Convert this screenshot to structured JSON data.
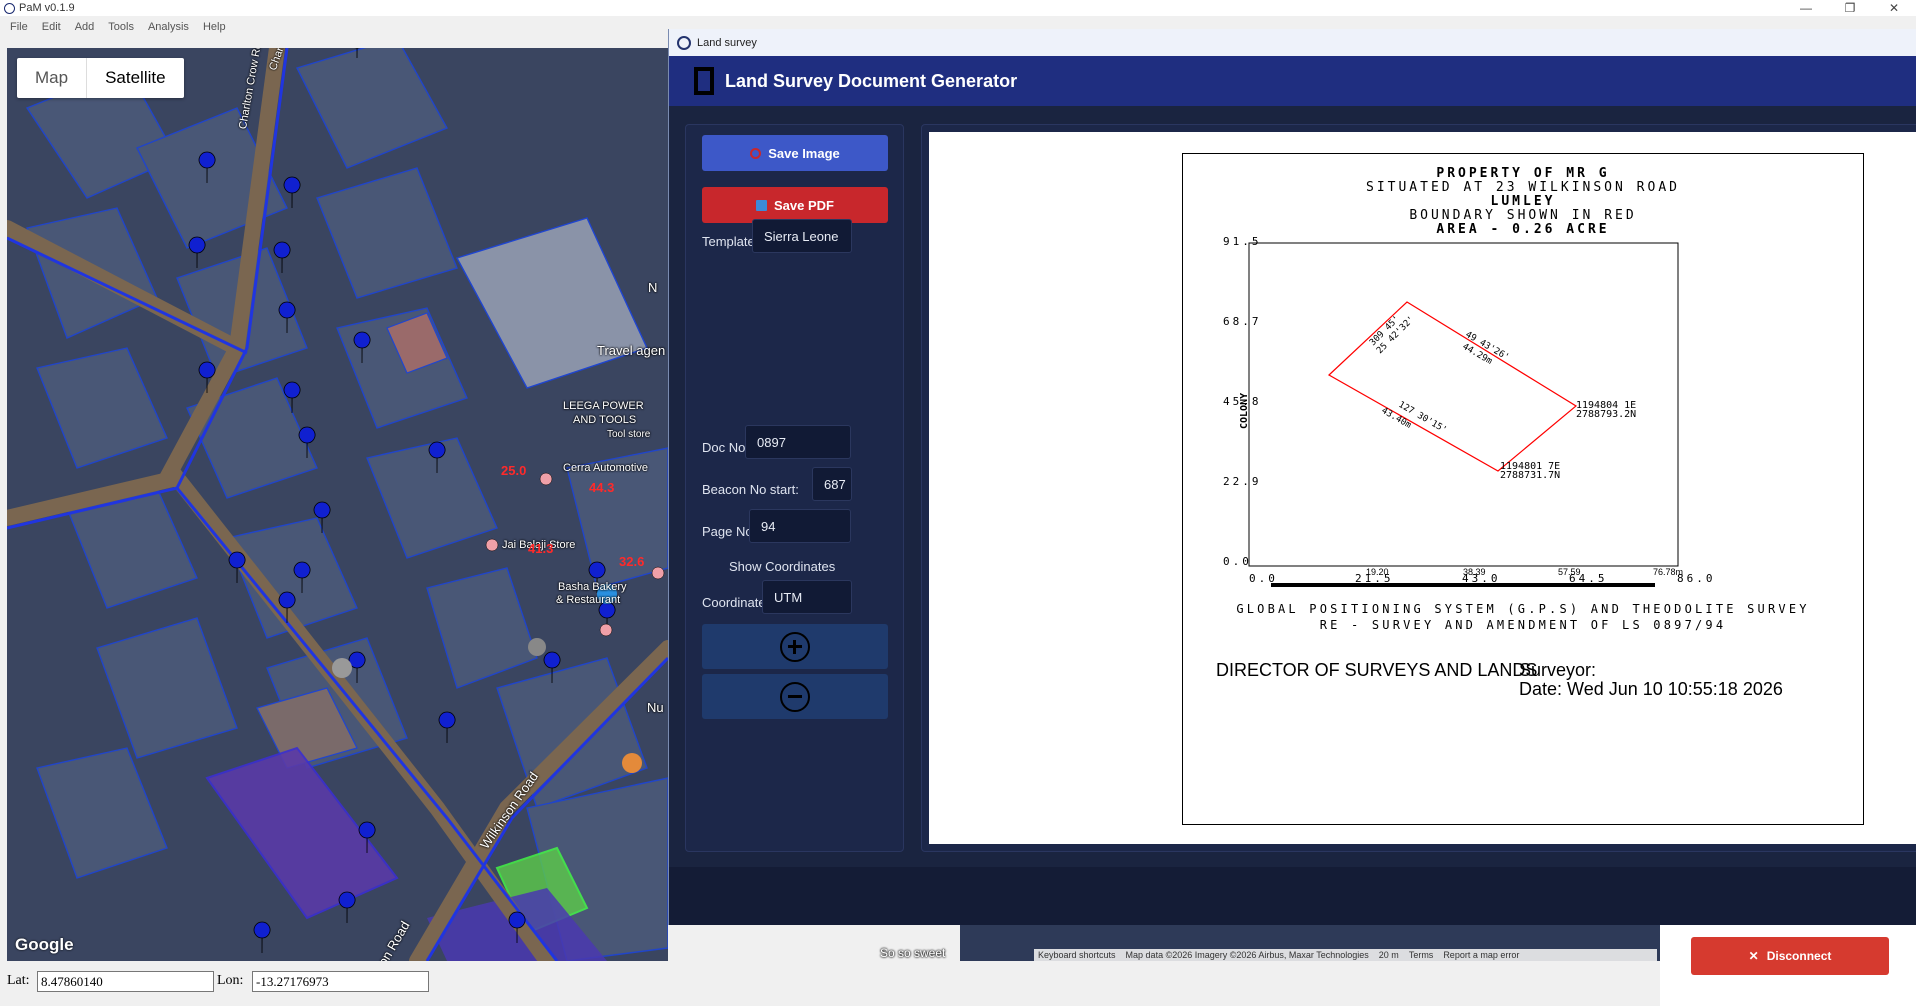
{
  "app": {
    "title": "PaM v0.1.9",
    "menu": [
      "File",
      "Edit",
      "Add",
      "Tools",
      "Analysis",
      "Help"
    ]
  },
  "map": {
    "type_options": [
      "Map",
      "Satellite"
    ],
    "active_type": "Satellite",
    "labels": {
      "road1": "Charlton Crow Rd",
      "road2": "Charlton Crow",
      "road3": "Wilkinson Road",
      "road4": "on Road",
      "travel": "Travel agen",
      "leega1": "LEEGA POWER",
      "leega2": "AND TOOLS",
      "leega3": "Tool store",
      "cerra": "Cerra Automotive",
      "jai": "Jai Balaji Store",
      "basha1": "Basha Bakery",
      "basha2": "& Restaurant",
      "soso": "So so sweet",
      "nu": "Nu",
      "n": "N"
    },
    "red_numbers": [
      "25.0",
      "44.3",
      "41.3",
      "32.6"
    ],
    "google": "Google",
    "attribution": [
      "Keyboard shortcuts",
      "Map data ©2026 Imagery ©2026 Airbus, Maxar Technologies",
      "20 m",
      "Terms",
      "Report a map error"
    ]
  },
  "coords": {
    "lat_label": "Lat:",
    "lat_value": "8.47860140",
    "lon_label": "Lon:",
    "lon_value": "-13.27176973"
  },
  "side": {
    "disconnect_label": "Disconnect"
  },
  "dialog": {
    "window_title": "Land survey",
    "header_title": "Land Survey Document Generator",
    "save_image": "Save Image",
    "save_pdf": "Save PDF",
    "template_label": "Template:",
    "template_value": "Sierra Leone",
    "doc_no_label": "Doc No:",
    "doc_no_value": "0897",
    "beacon_label": "Beacon No start:",
    "beacon_value": "687",
    "page_label": "Page No:",
    "page_value": "94",
    "show_coords_label": "Show Coordinates",
    "show_coords_checked": false,
    "coordinate_label": "Coordinate:",
    "coordinate_value": "UTM",
    "colors": {
      "header": "#1f2e80",
      "save_image": "#3d58c8",
      "save_pdf": "#c8272c",
      "boundary": "#ff0000"
    }
  },
  "document": {
    "heading": [
      "PROPERTY OF MR G",
      "SITUATED AT 23 WILKINSON ROAD",
      "LUMLEY",
      "BOUNDARY SHOWN IN RED",
      "AREA - 0.26 ACRE"
    ],
    "y_axis_ticks": [
      "0.0",
      "22.9",
      "45.8",
      "68.7",
      "91.5"
    ],
    "x_axis_ticks": [
      "0.0",
      "21.5",
      "43.0",
      "64.5",
      "86.0"
    ],
    "scale_ticks": [
      "19.20",
      "38.39",
      "57.59",
      "76.78m"
    ],
    "side_label": "COLONY",
    "bearings": [
      {
        "line1": "49 43'26'",
        "line2": "44.29m"
      },
      {
        "line1": "127 30'15'",
        "line2": "43.40m"
      },
      {
        "line1": "309 45'",
        "line2": "25 42'32'"
      }
    ],
    "beacons": [
      {
        "e": "1194804 1E",
        "n": "2788793.2N"
      },
      {
        "e": "1194801 7E",
        "n": "2788731.7N"
      }
    ],
    "survey_line1": "GLOBAL POSITIONING SYSTEM (G.P.S) AND THEODOLITE SURVEY",
    "survey_line2": "RE - SURVEY AND AMENDMENT OF LS 0897/94",
    "director": "DIRECTOR OF SURVEYS AND LANDS",
    "surveyor": "Surveyor:",
    "date": "Date: Wed Jun 10 10:55:18 2026"
  }
}
